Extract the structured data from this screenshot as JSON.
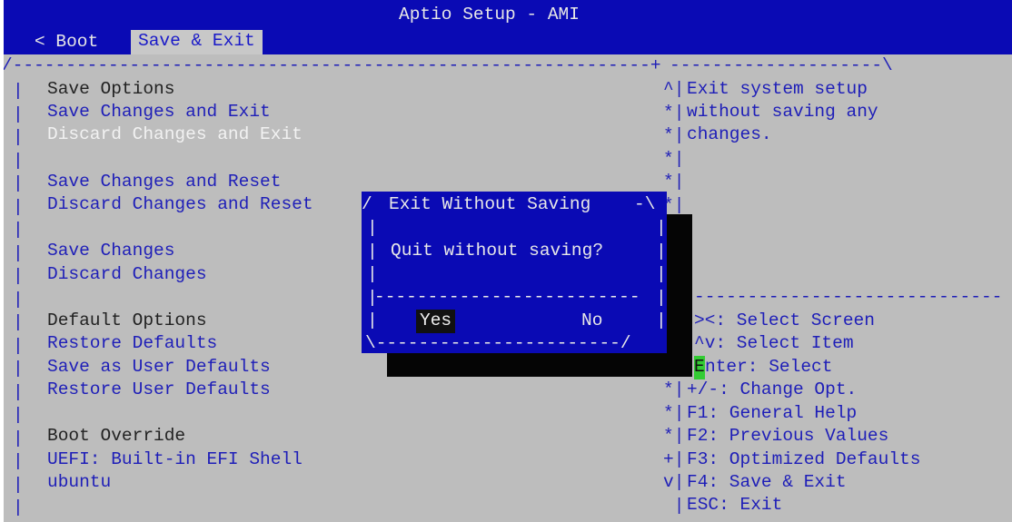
{
  "header": {
    "title": "Aptio Setup - AMI",
    "prev_tab": "< Boot",
    "active_tab": "Save & Exit"
  },
  "menu": {
    "save_options_heading": "Save Options",
    "save_changes_and_exit": "Save Changes and Exit",
    "discard_changes_and_exit": "Discard Changes and Exit",
    "save_changes_and_reset": "Save Changes and Reset",
    "discard_changes_and_reset": "Discard Changes and Reset",
    "save_changes": "Save Changes",
    "discard_changes": "Discard Changes",
    "default_options_heading": "Default Options",
    "restore_defaults": "Restore Defaults",
    "save_as_user_defaults": "Save as User Defaults",
    "restore_user_defaults": "Restore User Defaults",
    "boot_override_heading": "Boot Override",
    "uefi_shell": "UEFI: Built-in EFI Shell",
    "ubuntu": "ubuntu"
  },
  "help": {
    "line1": "Exit system setup",
    "line2": "without saving any",
    "line3": "changes."
  },
  "keys": {
    "select_screen": "><: Select Screen",
    "select_item": "^v: Select Item",
    "enter_key_char": "E",
    "enter_rest": "nter: Select",
    "change_opt": "+/-: Change Opt.",
    "general_help": "F1: General Help",
    "previous_values": "F2: Previous Values",
    "optimized_defaults": "F3: Optimized Defaults",
    "save_exit": "F4: Save & Exit",
    "esc_exit": "ESC: Exit"
  },
  "dialog": {
    "title": "Exit Without Saving",
    "message": "Quit without saving?",
    "yes": "Yes",
    "no": "No"
  }
}
